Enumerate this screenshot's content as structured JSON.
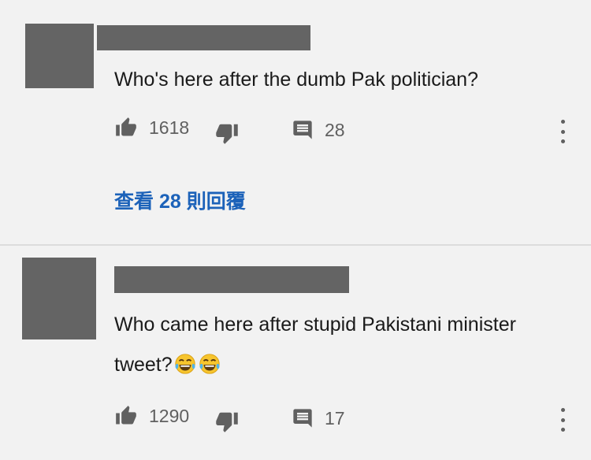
{
  "comments": [
    {
      "text": "Who's here after the dumb Pak politician?",
      "likes": "1618",
      "replies": "28",
      "view_replies_label": "查看 28 則回覆"
    },
    {
      "text_line1": "Who came here after stupid Pakistani minister",
      "text_line2": "tweet?",
      "emojis": [
        "face-with-tears-of-joy",
        "face-with-tears-of-joy"
      ],
      "likes": "1290",
      "replies": "17"
    }
  ],
  "colors": {
    "background": "#f2f2f2",
    "redaction": "#646464",
    "icon": "#606060",
    "link": "#1c62b9",
    "divider": "#dcdcdc"
  }
}
